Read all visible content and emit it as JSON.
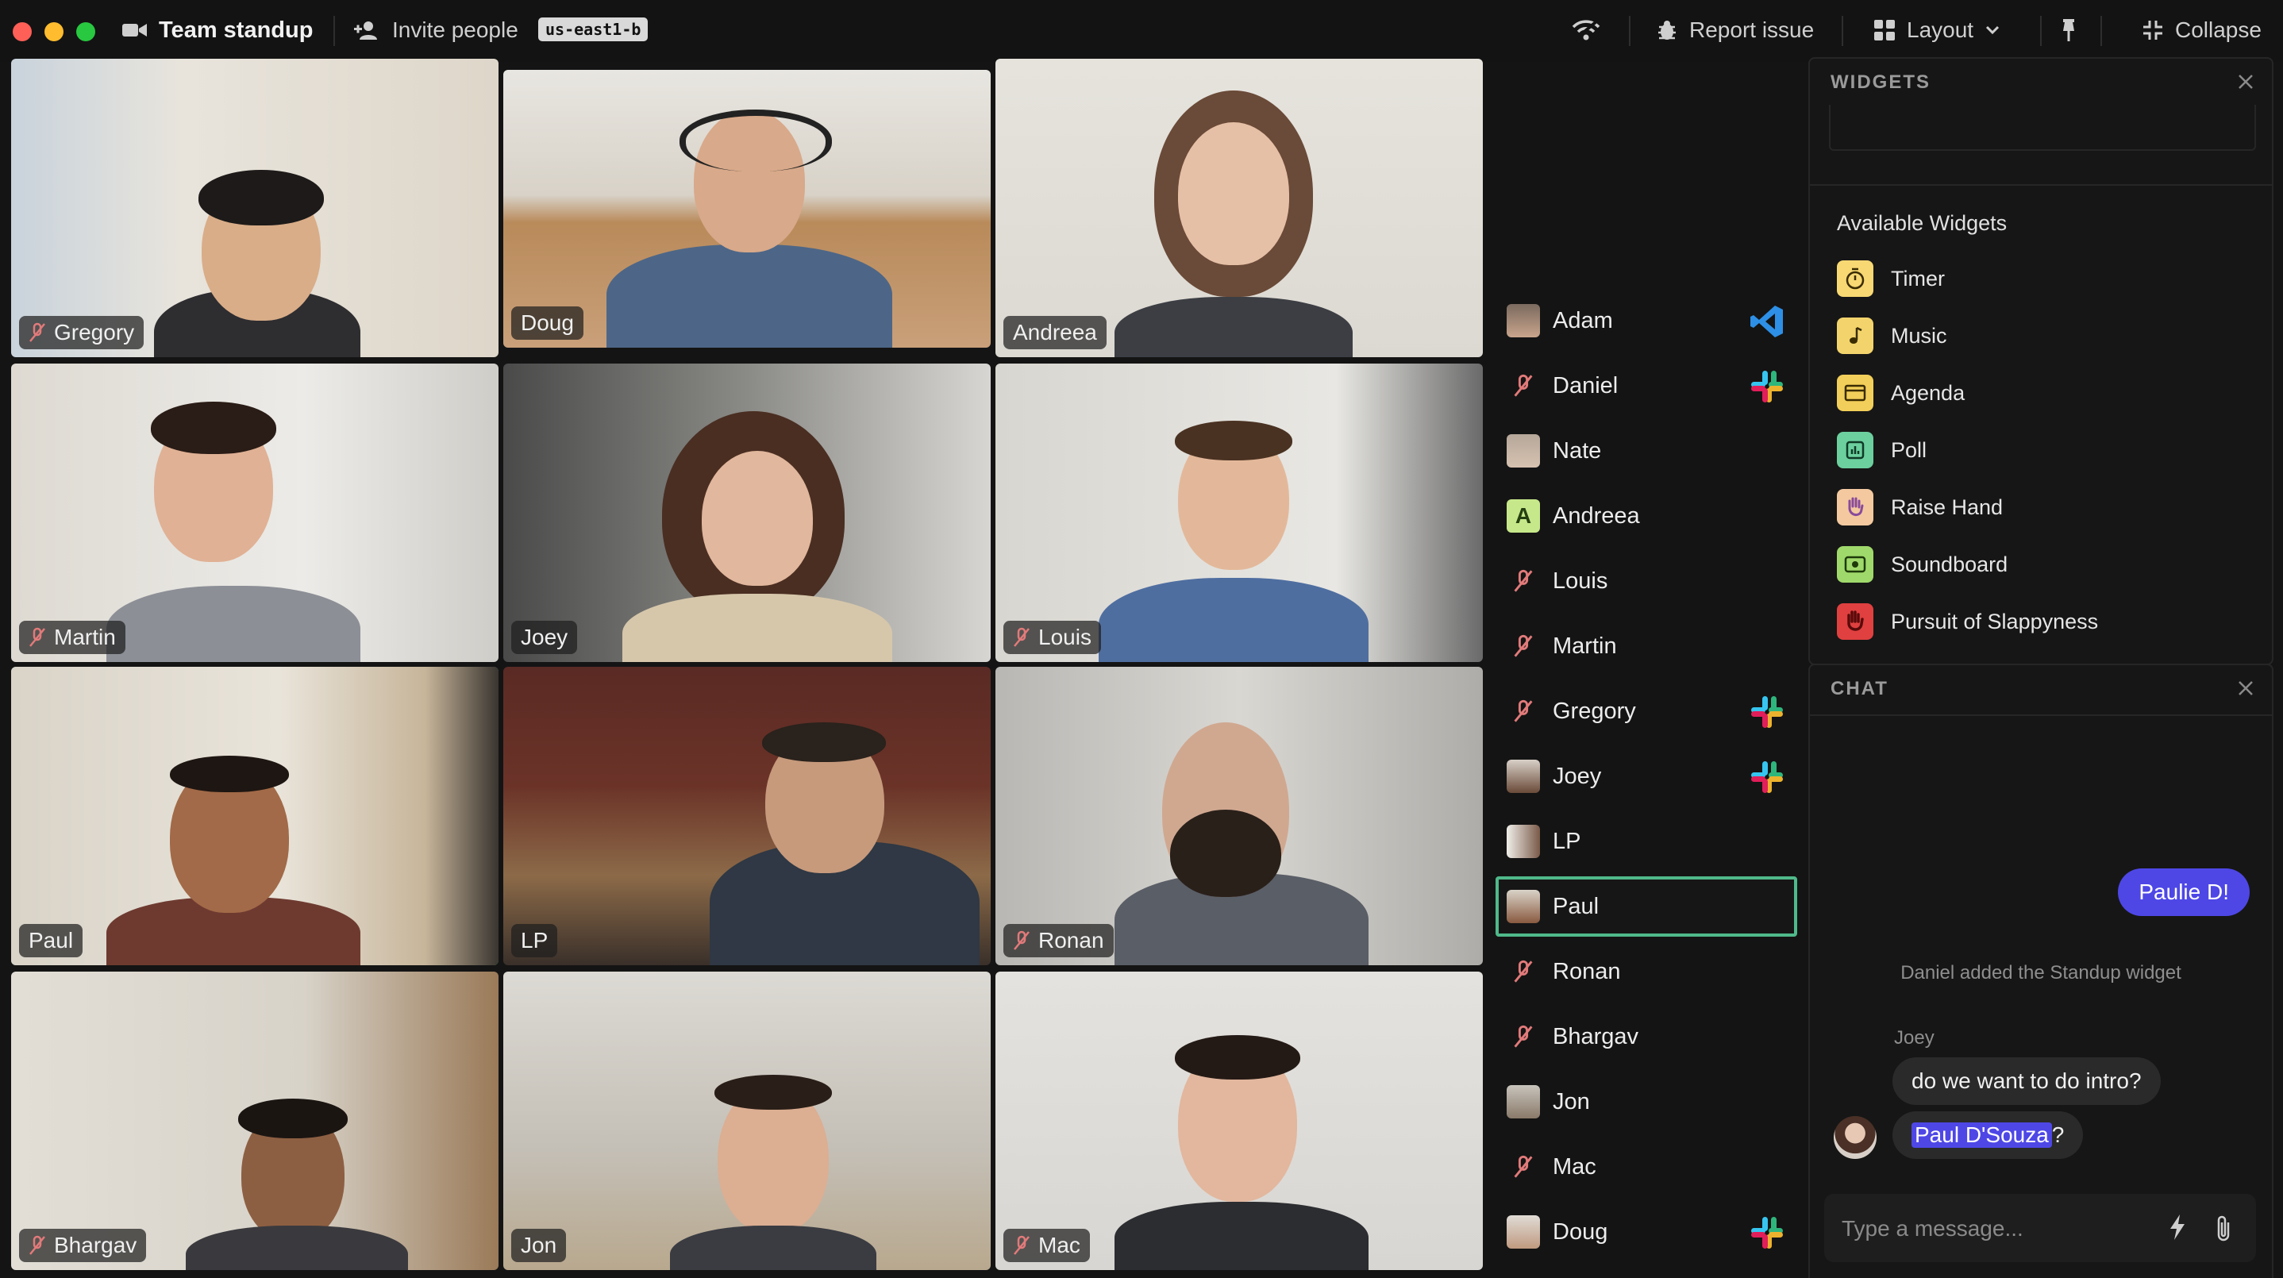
{
  "window": {
    "title": "Team standup",
    "invite_label": "Invite people",
    "region": "us-east1-b",
    "report_label": "Report issue",
    "layout_label": "Layout",
    "collapse_label": "Collapse"
  },
  "tiles": [
    {
      "name": "Gregory",
      "muted": true
    },
    {
      "name": "Doug",
      "muted": false
    },
    {
      "name": "Andreea",
      "muted": false
    },
    {
      "name": "Martin",
      "muted": true
    },
    {
      "name": "Joey",
      "muted": false
    },
    {
      "name": "Louis",
      "muted": true
    },
    {
      "name": "Paul",
      "muted": false,
      "speaking": true
    },
    {
      "name": "LP",
      "muted": false
    },
    {
      "name": "Ronan",
      "muted": true
    },
    {
      "name": "Bhargav",
      "muted": true
    },
    {
      "name": "Jon",
      "muted": false
    },
    {
      "name": "Mac",
      "muted": true
    }
  ],
  "participants": [
    {
      "name": "Adam",
      "avatar": "photo",
      "app": "vscode-icon"
    },
    {
      "name": "Daniel",
      "avatar": "muted",
      "app": "slack-icon"
    },
    {
      "name": "Nate",
      "avatar": "photo",
      "app": ""
    },
    {
      "name": "Andreea",
      "avatar": "initial",
      "initial": "A",
      "app": ""
    },
    {
      "name": "Louis",
      "avatar": "muted",
      "app": ""
    },
    {
      "name": "Martin",
      "avatar": "muted",
      "app": ""
    },
    {
      "name": "Gregory",
      "avatar": "muted",
      "app": "slack-icon"
    },
    {
      "name": "Joey",
      "avatar": "photo",
      "app": "slack-icon"
    },
    {
      "name": "LP",
      "avatar": "photo",
      "app": ""
    },
    {
      "name": "Paul",
      "avatar": "photo",
      "app": "",
      "active": true
    },
    {
      "name": "Ronan",
      "avatar": "muted",
      "app": ""
    },
    {
      "name": "Bhargav",
      "avatar": "muted",
      "app": ""
    },
    {
      "name": "Jon",
      "avatar": "photo",
      "app": ""
    },
    {
      "name": "Mac",
      "avatar": "muted",
      "app": ""
    },
    {
      "name": "Doug",
      "avatar": "photo",
      "app": "slack-icon"
    }
  ],
  "widgets": {
    "header": "WIDGETS",
    "available_title": "Available Widgets",
    "items": [
      {
        "label": "Timer",
        "icon": "timer-icon",
        "color": "#f7d873"
      },
      {
        "label": "Music",
        "icon": "music-note-icon",
        "color": "#f3d46c"
      },
      {
        "label": "Agenda",
        "icon": "agenda-icon",
        "color": "#f2cf5a"
      },
      {
        "label": "Poll",
        "icon": "poll-icon",
        "color": "#6ccf9e"
      },
      {
        "label": "Raise Hand",
        "icon": "raised-hand-icon",
        "color": "#f4c9a0"
      },
      {
        "label": "Soundboard",
        "icon": "soundboard-icon",
        "color": "#9fd96b"
      },
      {
        "label": "Pursuit of Slappyness",
        "icon": "slap-hand-icon",
        "color": "#e04040"
      }
    ]
  },
  "chat": {
    "header": "CHAT",
    "my_message": "Paulie D!",
    "system_message": "Daniel added the Standup widget",
    "sender": "Joey",
    "message_1": "do we want to do intro?",
    "mention": "Paul D'Souza",
    "message_2_suffix": " ?",
    "input_placeholder": "Type a message..."
  }
}
